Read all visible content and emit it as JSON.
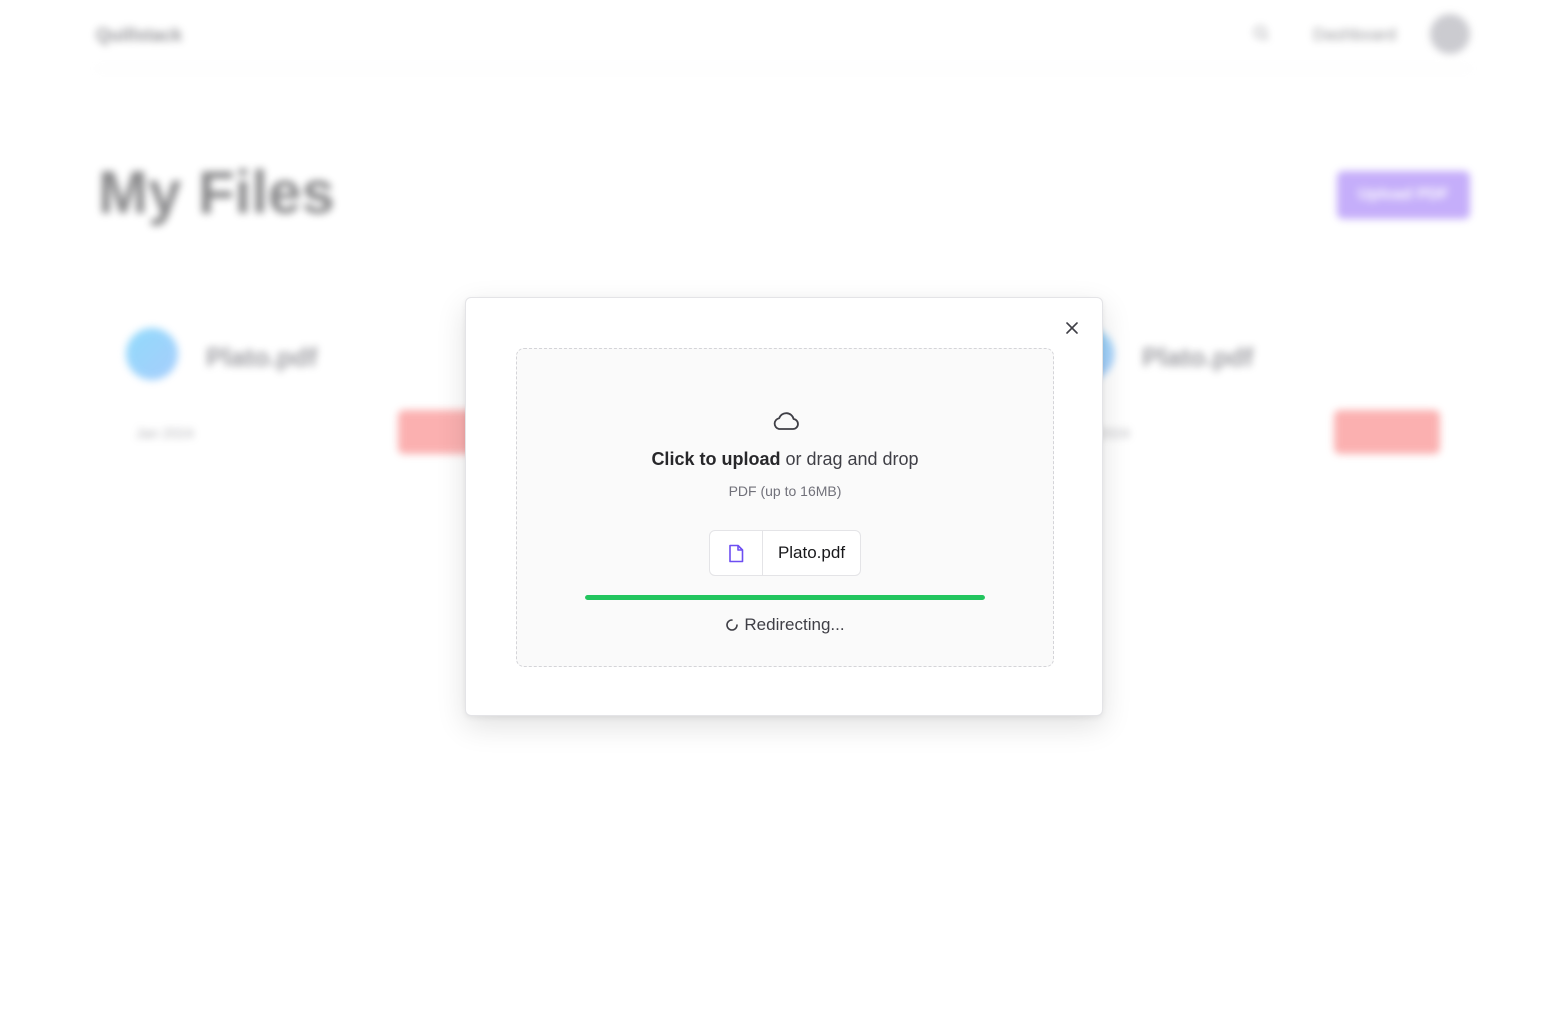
{
  "background_page": {
    "brand": "Quillstack",
    "nav": {
      "dashboard_label": "Dashboard"
    },
    "title": "My Files",
    "upload_button_label": "Upload PDF",
    "files": [
      {
        "name": "Plato.pdf",
        "meta": "Jan 2024"
      },
      {
        "name": "Plato.pdf",
        "meta": "Jan 2024"
      }
    ]
  },
  "upload_dialog": {
    "dropzone": {
      "title_bold": "Click to upload",
      "title_rest": " or drag and drop",
      "subtitle": "PDF (up to 16MB)"
    },
    "file": {
      "name": "Plato.pdf",
      "icon": "file-icon"
    },
    "progress": {
      "value": 1.0
    },
    "status_text": "Redirecting...",
    "icons": {
      "close": "close-icon",
      "cloud": "cloud-icon",
      "spinner": "spinner-icon"
    }
  },
  "colors": {
    "accent": "#7c5cf5",
    "progress": "#22c55e",
    "danger": "#f87171"
  }
}
